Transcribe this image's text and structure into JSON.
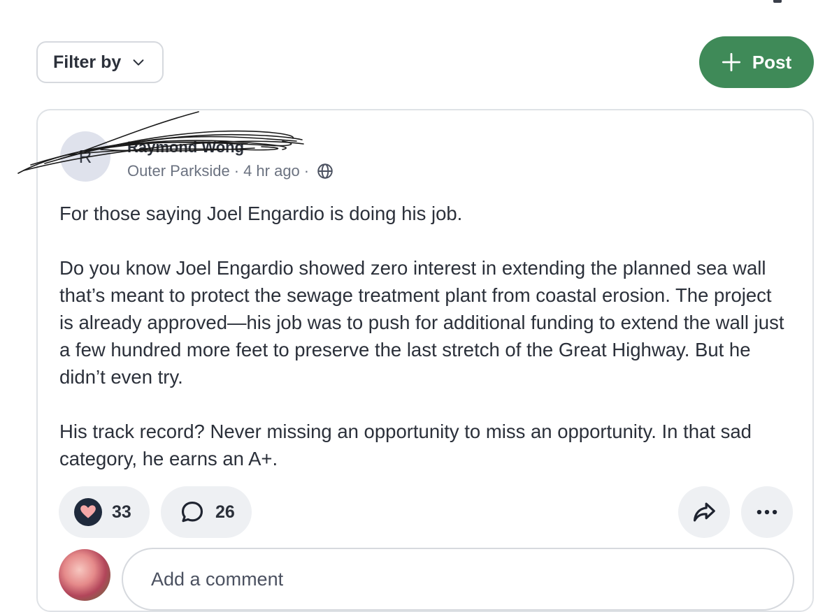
{
  "toolbar": {
    "filter_label": "Filter by",
    "post_label": "Post"
  },
  "post": {
    "author_initial": "R",
    "author_name": "Raymond Wong",
    "neighborhood": "Outer Parkside",
    "separator": "·",
    "time_ago": "4 hr ago",
    "visibility_icon": "globe-icon",
    "paragraphs": [
      "For those saying Joel Engardio is doing his job.",
      "Do you know Joel Engardio showed zero interest in extending the planned sea wall that’s meant to protect the sewage treatment plant from coastal erosion. The project is already approved—his job was to push for additional funding to extend the wall just a few hundred more feet to preserve the last stretch of the Great Highway. But he didn’t even try.",
      "His track record? Never missing an opportunity to miss an opportunity. In that sad category, he earns an A+."
    ],
    "reaction_count": "33",
    "comment_count": "26"
  },
  "comment_box": {
    "placeholder": "Add a comment"
  },
  "colors": {
    "accent": "#3f8a58",
    "pill_bg": "#eef0f3",
    "heart": "#f4a7a7"
  }
}
